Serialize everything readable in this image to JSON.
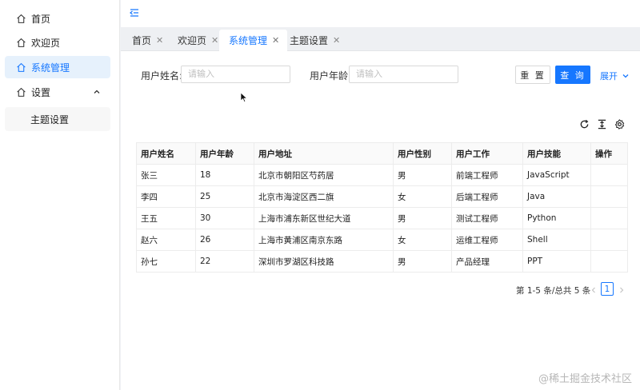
{
  "sidebar": {
    "items": [
      {
        "label": "首页",
        "icon": "home-icon"
      },
      {
        "label": "欢迎页",
        "icon": "home-icon"
      },
      {
        "label": "系统管理",
        "icon": "home-icon",
        "active": true
      },
      {
        "label": "设置",
        "icon": "home-icon",
        "expanded": true
      }
    ],
    "submenu": [
      {
        "label": "主题设置"
      }
    ]
  },
  "header": {
    "fold_icon": "menu-fold-icon"
  },
  "tabs": [
    {
      "label": "首页"
    },
    {
      "label": "欢迎页"
    },
    {
      "label": "系统管理",
      "active": true
    },
    {
      "label": "主题设置"
    }
  ],
  "search": {
    "name_label": "用户姓名:",
    "name_placeholder": "请输入",
    "age_label": "用户年龄:",
    "age_placeholder": "请输入",
    "reset_label": "重 置",
    "query_label": "查 询",
    "expand_label": "展开"
  },
  "toolbar": {
    "icons": [
      "reload-icon",
      "column-height-icon",
      "setting-icon"
    ]
  },
  "table": {
    "columns": [
      "用户姓名",
      "用户年龄",
      "用户地址",
      "用户性别",
      "用户工作",
      "用户技能",
      "操作"
    ],
    "rows": [
      [
        "张三",
        "18",
        "北京市朝阳区芍药居",
        "男",
        "前端工程师",
        "JavaScript",
        ""
      ],
      [
        "李四",
        "25",
        "北京市海淀区西二旗",
        "女",
        "后端工程师",
        "Java",
        ""
      ],
      [
        "王五",
        "30",
        "上海市浦东新区世纪大道",
        "男",
        "测试工程师",
        "Python",
        ""
      ],
      [
        "赵六",
        "26",
        "上海市黄浦区南京东路",
        "女",
        "运维工程师",
        "Shell",
        ""
      ],
      [
        "孙七",
        "22",
        "深圳市罗湖区科技路",
        "男",
        "产品经理",
        "PPT",
        ""
      ]
    ]
  },
  "pagination": {
    "summary": "第 1-5 条/总共 5 条",
    "current_page": "1"
  },
  "watermark": "@稀土掘金技术社区",
  "colors": {
    "primary": "#1677ff",
    "active_bg": "#e6f1fc"
  }
}
